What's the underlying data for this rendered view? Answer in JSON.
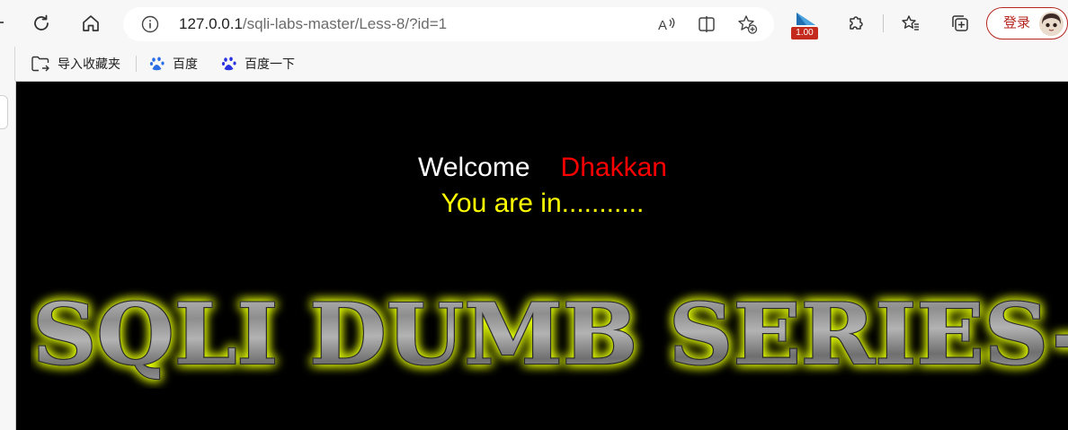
{
  "browser": {
    "url_host": "127.0.0.1",
    "url_path": "/sqli-labs-master/Less-8/?id=1",
    "extension_badge": "1.00",
    "login_label": "登录"
  },
  "favorites": {
    "import_label": "导入收藏夹",
    "items": [
      {
        "label": "百度",
        "icon": "baidu-paw-icon"
      },
      {
        "label": "百度一下",
        "icon": "baidu-paw-icon"
      }
    ]
  },
  "page": {
    "welcome_label": "Welcome",
    "welcome_name": "Dhakkan",
    "status_message": "You are in...........",
    "banner_text": "SQLI DUMB SERIES-"
  },
  "colors": {
    "page_background": "#000000",
    "welcome": "#ffffff",
    "name": "#ff0000",
    "status": "#ffff00",
    "banner_glow": "#e6ff00",
    "login_accent": "#b5261e"
  }
}
